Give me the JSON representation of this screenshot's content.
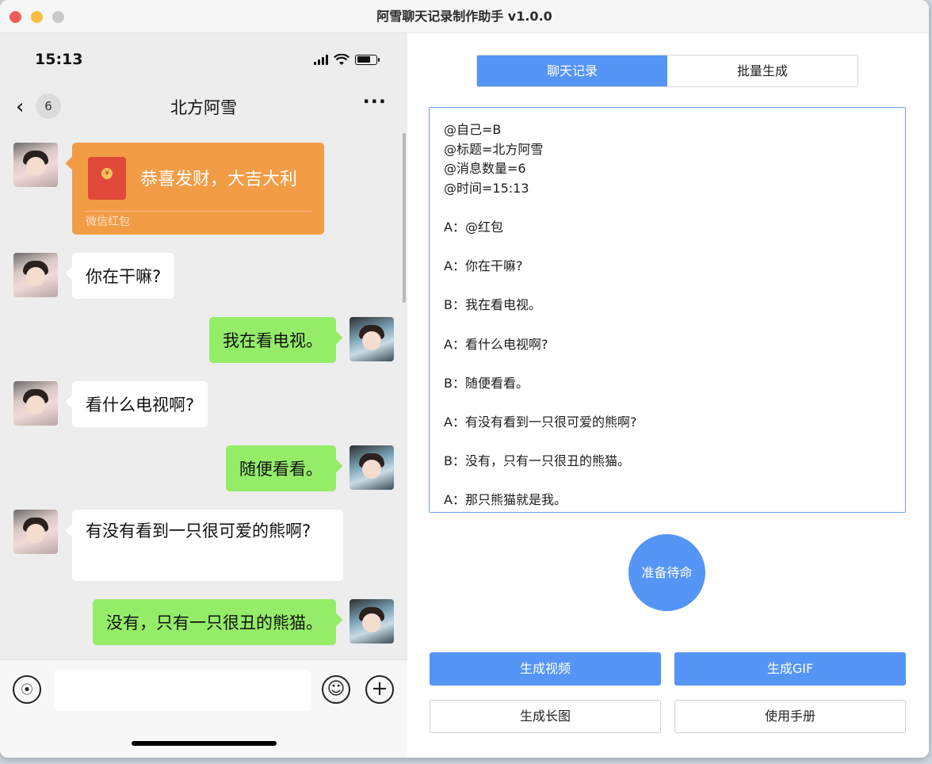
{
  "window": {
    "title": "阿雪聊天记录制作助手 v1.0.0"
  },
  "phone": {
    "status_time": "15:13",
    "nav": {
      "badge": "6",
      "title": "北方阿雪",
      "more": "···"
    },
    "red_packet": {
      "greeting": "恭喜发财，大吉大利",
      "label": "微信红包"
    },
    "messages": [
      {
        "sender": "A",
        "text": "你在干嘛?"
      },
      {
        "sender": "B",
        "text": "我在看电视。"
      },
      {
        "sender": "A",
        "text": "看什么电视啊?"
      },
      {
        "sender": "B",
        "text": "随便看看。"
      },
      {
        "sender": "A",
        "text": "有没有看到一只很可爱的熊啊?"
      },
      {
        "sender": "B",
        "text": "没有，只有一只很丑的熊猫。"
      }
    ],
    "colors": {
      "incoming": "#ffffff",
      "outgoing": "#95ec69",
      "red_packet": "#f39c46"
    }
  },
  "panel": {
    "tabs": [
      {
        "label": "聊天记录",
        "active": true
      },
      {
        "label": "批量生成",
        "active": false
      }
    ],
    "script_text": "@自己=B\n@标题=北方阿雪\n@消息数量=6\n@时间=15:13\n\nA：@红包\n\nA：你在干嘛?\n\nB：我在看电视。\n\nA：看什么电视啊?\n\nB：随便看看。\n\nA：有没有看到一只很可爱的熊啊?\n\nB：没有，只有一只很丑的熊猫。\n\nA：那只熊猫就是我。",
    "status_label": "准备待命",
    "buttons": {
      "generate_video": "生成视频",
      "generate_gif": "生成GIF",
      "generate_long_image": "生成长图",
      "manual": "使用手册"
    },
    "accent_color": "#5595f5"
  }
}
